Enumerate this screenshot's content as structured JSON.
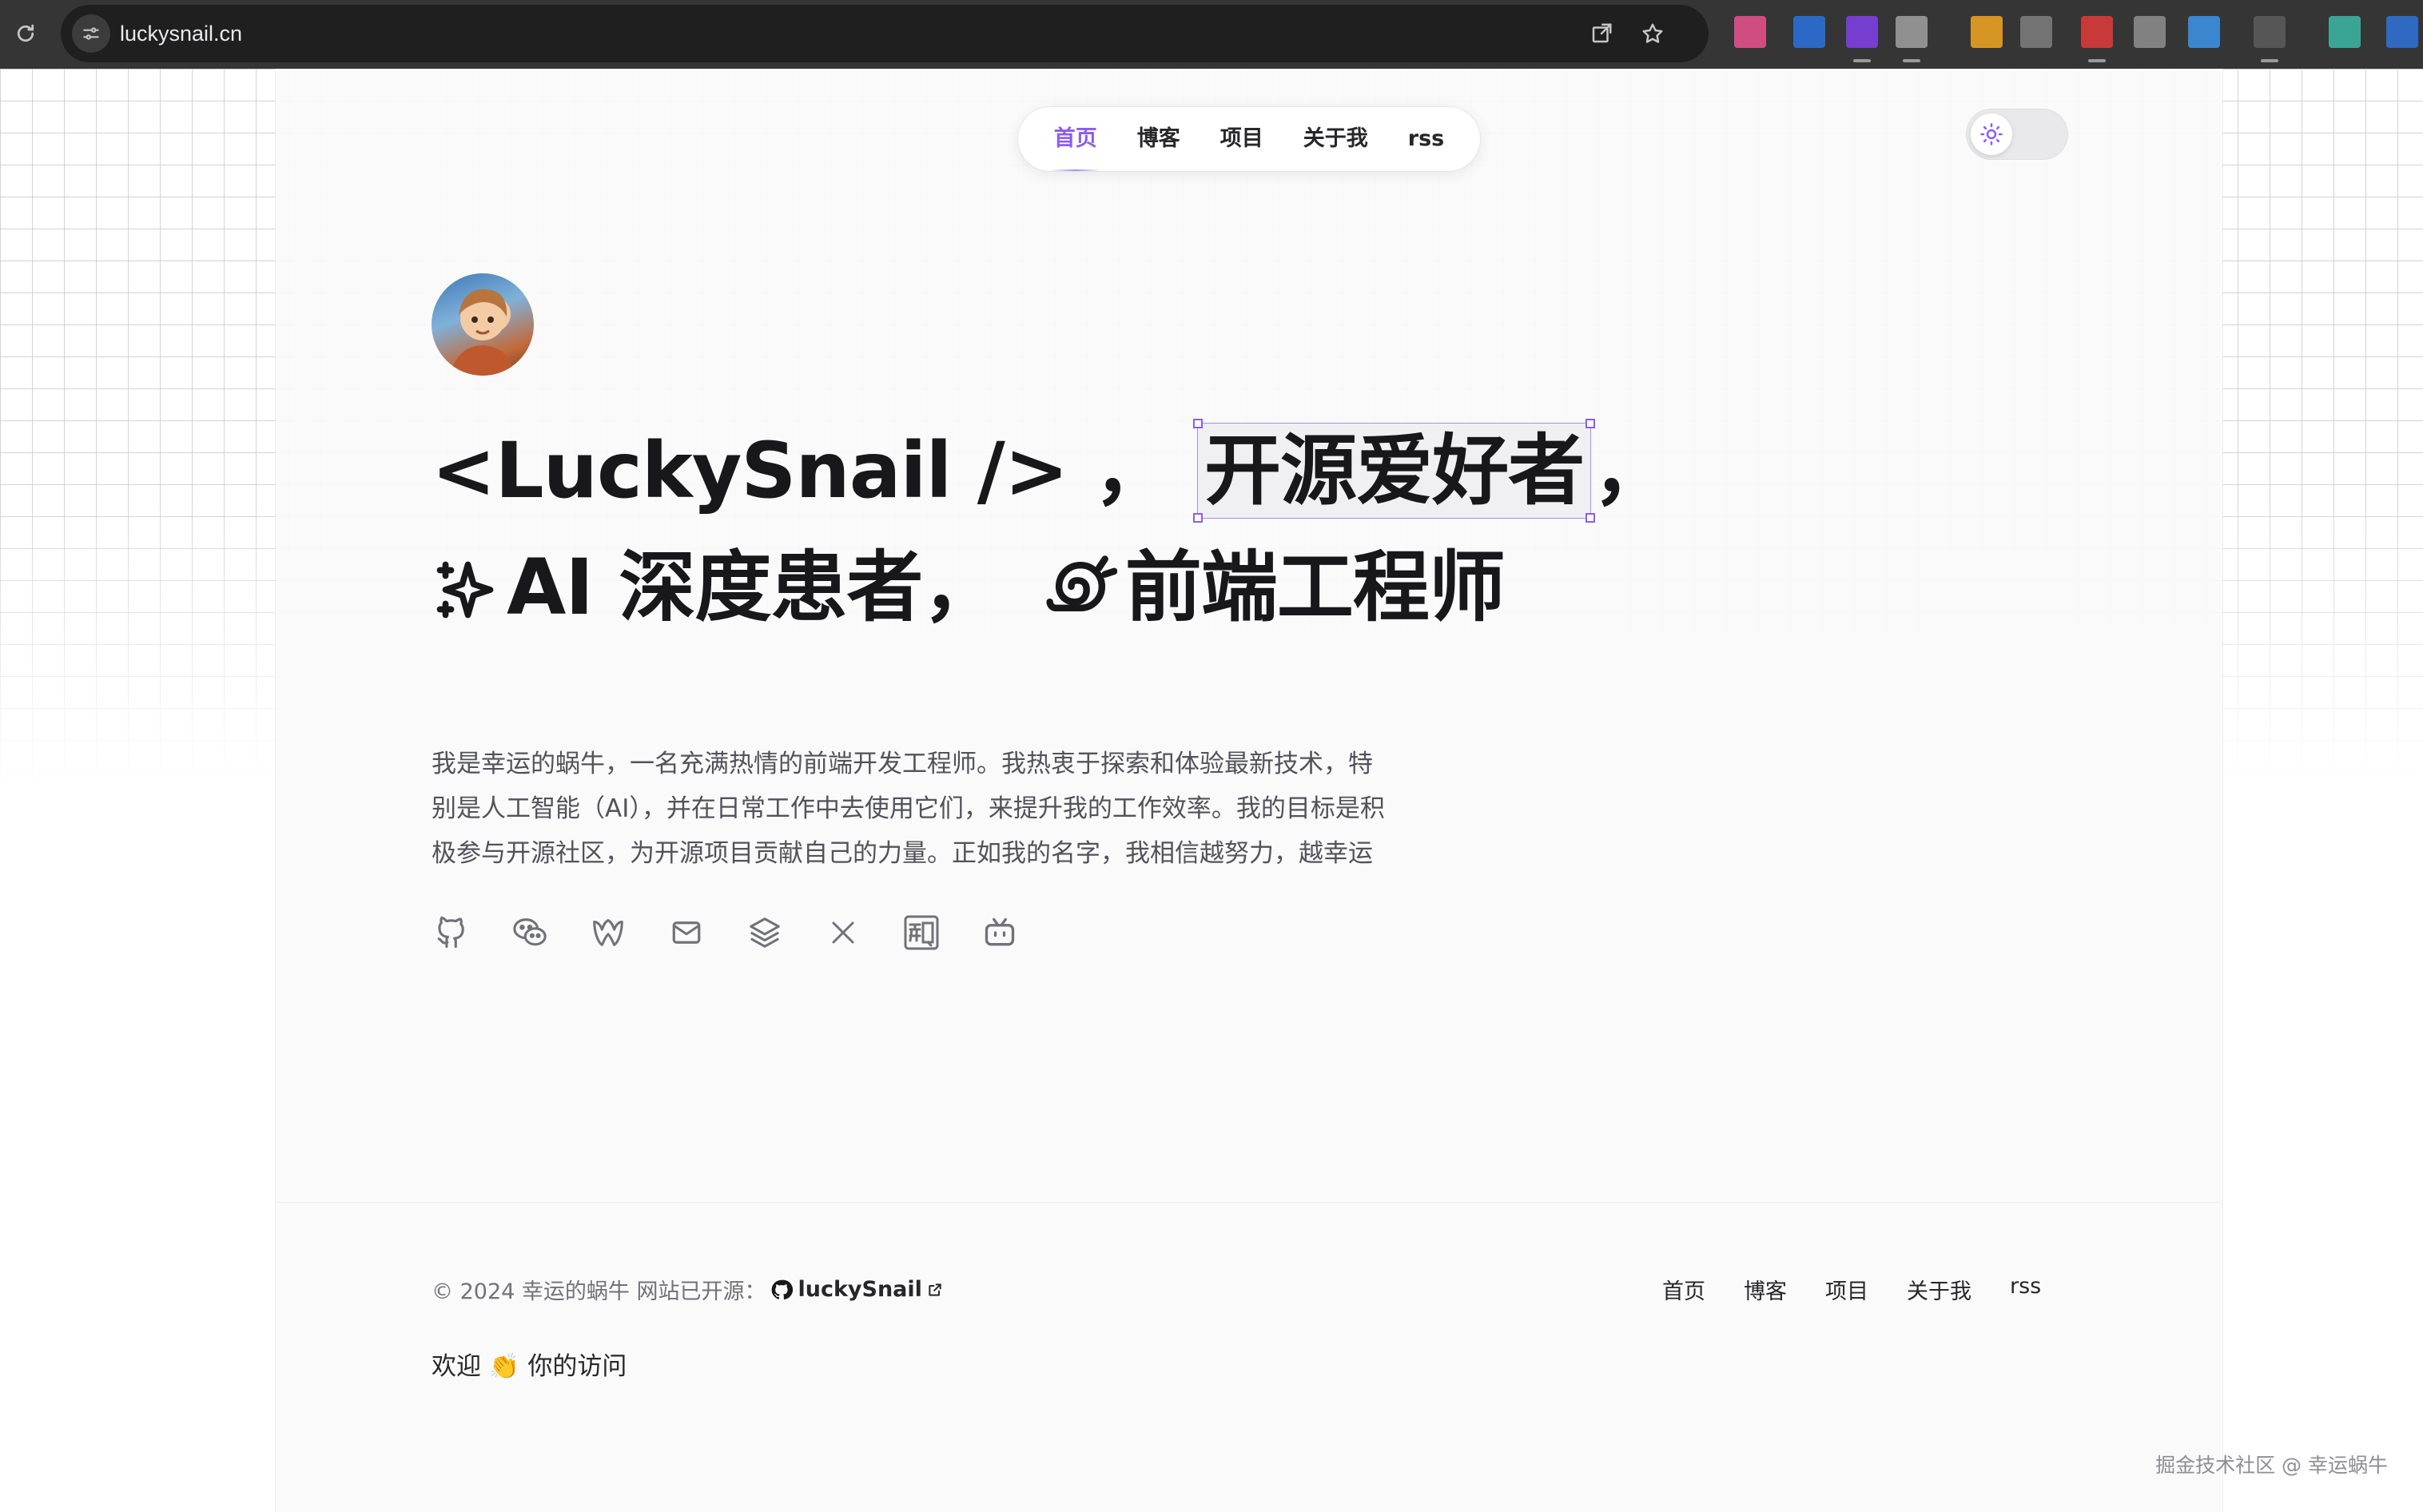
{
  "browser": {
    "url": "luckysnail.cn",
    "icons": [
      "reload-icon",
      "site-info-icon",
      "open-in-window-icon",
      "bookmark-star-icon"
    ],
    "extension_colors": [
      "#e0508a",
      "#2b6fd6",
      "#7c3fe0",
      "#9a9a9a",
      "#e8a020",
      "#7a7a7a",
      "#d83a3a",
      "#8a8a8a",
      "#3b8fe0",
      "#5a5a5a",
      "#3bb0a0",
      "#2f6fd0"
    ]
  },
  "nav": {
    "items": [
      "首页",
      "博客",
      "项目",
      "关于我",
      "rss"
    ],
    "active_index": 0,
    "accent": "#8b5cf6"
  },
  "theme_toggle": {
    "icon": "sun-icon",
    "mode": "light"
  },
  "hero": {
    "name_tag": "<LuckySnail />",
    "sep1": "，",
    "highlight": "开源爱好者",
    "sep2": "，",
    "sparkle_icon": "sparkles-icon",
    "ai_text": "AI 深度患者，",
    "snail_icon": "snail-icon",
    "role": "前端工程师",
    "bio_lines": [
      "我是幸运的蜗牛，一名充满热情的前端开发工程师。我热衷于探索和体验最新技术，特",
      "别是人工智能（AI），并在日常工作中去使用它们，来提升我的工作效率。我的目标是积",
      "极参与开源社区，为开源项目贡献自己的力量。正如我的名字，我相信越努力，越幸运"
    ]
  },
  "socials": [
    "github-icon",
    "wechat-icon",
    "juejin-icon",
    "email-icon",
    "stack-icon",
    "x-icon",
    "zhihu-icon",
    "bilibili-icon"
  ],
  "footer": {
    "copyright": "© 2024 幸运的蜗牛 网站已开源：",
    "repo": "luckySnail",
    "nav": [
      "首页",
      "博客",
      "项目",
      "关于我",
      "rss"
    ],
    "welcome_pre": "欢迎",
    "welcome_emoji": "👏",
    "welcome_post": "你的访问"
  },
  "watermark": "掘金技术社区 @ 幸运蜗牛"
}
